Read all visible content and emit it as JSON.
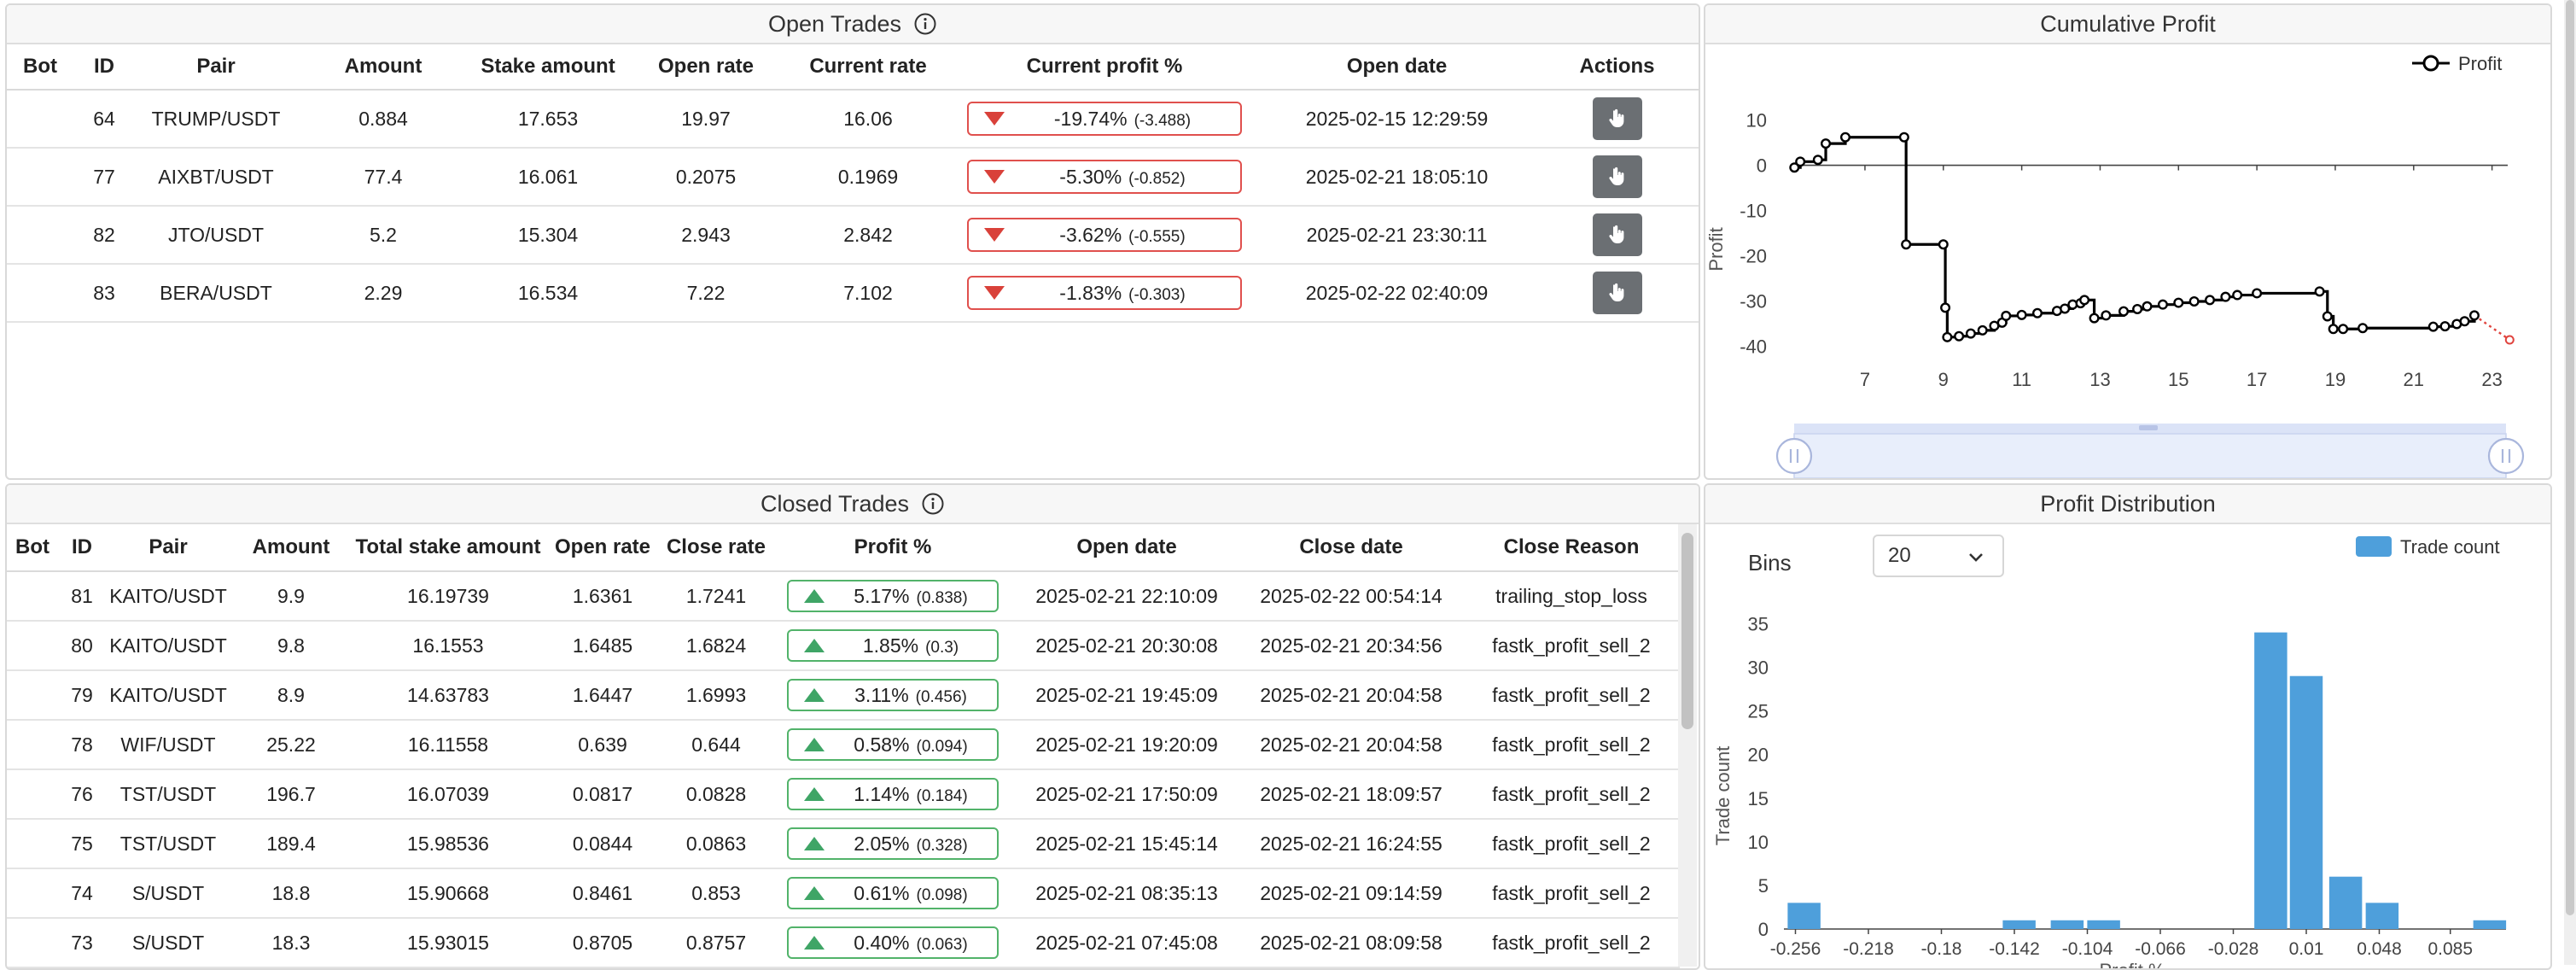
{
  "open_trades": {
    "title": "Open Trades",
    "columns": [
      "Bot",
      "ID",
      "Pair",
      "Amount",
      "Stake amount",
      "Open rate",
      "Current rate",
      "Current profit %",
      "Open date",
      "Actions"
    ],
    "rows": [
      {
        "bot": "",
        "id": "64",
        "pair": "TRUMP/USDT",
        "amount": "0.884",
        "stake": "17.653",
        "open_rate": "19.97",
        "current_rate": "16.06",
        "profit": "-19.74%",
        "profit_abs": "(-3.488)",
        "open_date": "2025-02-15 12:29:59"
      },
      {
        "bot": "",
        "id": "77",
        "pair": "AIXBT/USDT",
        "amount": "77.4",
        "stake": "16.061",
        "open_rate": "0.2075",
        "current_rate": "0.1969",
        "profit": "-5.30%",
        "profit_abs": "(-0.852)",
        "open_date": "2025-02-21 18:05:10"
      },
      {
        "bot": "",
        "id": "82",
        "pair": "JTO/USDT",
        "amount": "5.2",
        "stake": "15.304",
        "open_rate": "2.943",
        "current_rate": "2.842",
        "profit": "-3.62%",
        "profit_abs": "(-0.555)",
        "open_date": "2025-02-21 23:30:11"
      },
      {
        "bot": "",
        "id": "83",
        "pair": "BERA/USDT",
        "amount": "2.29",
        "stake": "16.534",
        "open_rate": "7.22",
        "current_rate": "7.102",
        "profit": "-1.83%",
        "profit_abs": "(-0.303)",
        "open_date": "2025-02-22 02:40:09"
      }
    ]
  },
  "closed_trades": {
    "title": "Closed Trades",
    "columns": [
      "Bot",
      "ID",
      "Pair",
      "Amount",
      "Total stake amount",
      "Open rate",
      "Close rate",
      "Profit %",
      "Open date",
      "Close date",
      "Close Reason"
    ],
    "rows": [
      {
        "bot": "",
        "id": "81",
        "pair": "KAITO/USDT",
        "amount": "9.9",
        "stake": "16.19739",
        "open_rate": "1.6361",
        "close_rate": "1.7241",
        "profit": "5.17%",
        "profit_abs": "(0.838)",
        "open_date": "2025-02-21 22:10:09",
        "close_date": "2025-02-22 00:54:14",
        "reason": "trailing_stop_loss"
      },
      {
        "bot": "",
        "id": "80",
        "pair": "KAITO/USDT",
        "amount": "9.8",
        "stake": "16.1553",
        "open_rate": "1.6485",
        "close_rate": "1.6824",
        "profit": "1.85%",
        "profit_abs": "(0.3)",
        "open_date": "2025-02-21 20:30:08",
        "close_date": "2025-02-21 20:34:56",
        "reason": "fastk_profit_sell_2"
      },
      {
        "bot": "",
        "id": "79",
        "pair": "KAITO/USDT",
        "amount": "8.9",
        "stake": "14.63783",
        "open_rate": "1.6447",
        "close_rate": "1.6993",
        "profit": "3.11%",
        "profit_abs": "(0.456)",
        "open_date": "2025-02-21 19:45:09",
        "close_date": "2025-02-21 20:04:58",
        "reason": "fastk_profit_sell_2"
      },
      {
        "bot": "",
        "id": "78",
        "pair": "WIF/USDT",
        "amount": "25.22",
        "stake": "16.11558",
        "open_rate": "0.639",
        "close_rate": "0.644",
        "profit": "0.58%",
        "profit_abs": "(0.094)",
        "open_date": "2025-02-21 19:20:09",
        "close_date": "2025-02-21 20:04:58",
        "reason": "fastk_profit_sell_2"
      },
      {
        "bot": "",
        "id": "76",
        "pair": "TST/USDT",
        "amount": "196.7",
        "stake": "16.07039",
        "open_rate": "0.0817",
        "close_rate": "0.0828",
        "profit": "1.14%",
        "profit_abs": "(0.184)",
        "open_date": "2025-02-21 17:50:09",
        "close_date": "2025-02-21 18:09:57",
        "reason": "fastk_profit_sell_2"
      },
      {
        "bot": "",
        "id": "75",
        "pair": "TST/USDT",
        "amount": "189.4",
        "stake": "15.98536",
        "open_rate": "0.0844",
        "close_rate": "0.0863",
        "profit": "2.05%",
        "profit_abs": "(0.328)",
        "open_date": "2025-02-21 15:45:14",
        "close_date": "2025-02-21 16:24:55",
        "reason": "fastk_profit_sell_2"
      },
      {
        "bot": "",
        "id": "74",
        "pair": "S/USDT",
        "amount": "18.8",
        "stake": "15.90668",
        "open_rate": "0.8461",
        "close_rate": "0.853",
        "profit": "0.61%",
        "profit_abs": "(0.098)",
        "open_date": "2025-02-21 08:35:13",
        "close_date": "2025-02-21 09:14:59",
        "reason": "fastk_profit_sell_2"
      },
      {
        "bot": "",
        "id": "73",
        "pair": "S/USDT",
        "amount": "18.3",
        "stake": "15.93015",
        "open_rate": "0.8705",
        "close_rate": "0.8757",
        "profit": "0.40%",
        "profit_abs": "(0.063)",
        "open_date": "2025-02-21 07:45:08",
        "close_date": "2025-02-21 08:09:58",
        "reason": "fastk_profit_sell_2"
      }
    ]
  },
  "cumulative_profit": {
    "title": "Cumulative Profit",
    "legend": "Profit",
    "ylabel": "Profit",
    "colors": {
      "line": "#000000",
      "projection": "#e0443e",
      "zoom": "#dbe3f7"
    }
  },
  "profit_distribution": {
    "title": "Profit Distribution",
    "bins_label": "Bins",
    "bins_value": "20",
    "legend": "Trade count",
    "color": "#4e9fdb"
  },
  "chart_data": [
    {
      "type": "line",
      "title": "Cumulative Profit",
      "ylabel": "Profit",
      "xlabel": "",
      "series_name": "Profit",
      "x_ticks": [
        "7",
        "9",
        "11",
        "13",
        "15",
        "17",
        "19",
        "21",
        "23"
      ],
      "y_ticks": [
        "10",
        "0",
        "-10",
        "-20",
        "-30",
        "-40"
      ],
      "xlim": [
        5.15,
        23.4
      ],
      "ylim": [
        -42,
        12
      ],
      "points": [
        [
          5.2,
          -0.5
        ],
        [
          5.35,
          0.8
        ],
        [
          5.8,
          1.2
        ],
        [
          6.0,
          4.8
        ],
        [
          6.5,
          6.2
        ],
        [
          8.0,
          6.2
        ],
        [
          8.05,
          -17.5
        ],
        [
          9.0,
          -17.5
        ],
        [
          9.05,
          -31.5
        ],
        [
          9.1,
          -38.0
        ],
        [
          9.4,
          -37.8
        ],
        [
          9.7,
          -37.2
        ],
        [
          10.0,
          -36.5
        ],
        [
          10.3,
          -35.5
        ],
        [
          10.5,
          -34.8
        ],
        [
          10.6,
          -33.3
        ],
        [
          11.0,
          -33.1
        ],
        [
          11.4,
          -32.7
        ],
        [
          11.9,
          -32.2
        ],
        [
          12.1,
          -31.7
        ],
        [
          12.3,
          -30.8
        ],
        [
          12.5,
          -30.5
        ],
        [
          12.6,
          -29.8
        ],
        [
          12.85,
          -33.8
        ],
        [
          13.15,
          -33.2
        ],
        [
          13.6,
          -32.3
        ],
        [
          13.95,
          -31.8
        ],
        [
          14.2,
          -31.2
        ],
        [
          14.6,
          -30.8
        ],
        [
          15.0,
          -30.4
        ],
        [
          15.4,
          -30.1
        ],
        [
          15.8,
          -29.8
        ],
        [
          16.2,
          -29.1
        ],
        [
          16.5,
          -28.7
        ],
        [
          17.0,
          -28.3
        ],
        [
          18.6,
          -27.9
        ],
        [
          18.8,
          -33.4
        ],
        [
          18.95,
          -36.2
        ],
        [
          19.2,
          -36.2
        ],
        [
          19.7,
          -36.0
        ],
        [
          21.5,
          -35.7
        ],
        [
          21.8,
          -35.6
        ],
        [
          22.1,
          -35.1
        ],
        [
          22.3,
          -34.5
        ],
        [
          22.55,
          -33.2
        ]
      ],
      "projection": [
        [
          22.55,
          -33.2
        ],
        [
          23.45,
          -38.6
        ]
      ]
    },
    {
      "type": "bar",
      "title": "Profit Distribution",
      "xlabel": "Profit %",
      "ylabel": "Trade count",
      "series_name": "Trade count",
      "x_ticks": [
        "-0.256",
        "-0.218",
        "-0.18",
        "-0.142",
        "-0.104",
        "-0.066",
        "-0.028",
        "0.01",
        "0.048",
        "0.085"
      ],
      "y_ticks": [
        "0",
        "5",
        "10",
        "15",
        "20",
        "25",
        "30",
        "35"
      ],
      "xlim": [
        -0.262,
        0.114
      ],
      "ylim": [
        0,
        37
      ],
      "bin_width": 0.0171,
      "bins": [
        {
          "center": -0.2515,
          "count": 3
        },
        {
          "center": -0.1395,
          "count": 1
        },
        {
          "center": -0.1145,
          "count": 1
        },
        {
          "center": -0.0955,
          "count": 1
        },
        {
          "center": -0.0085,
          "count": 34
        },
        {
          "center": 0.01,
          "count": 29
        },
        {
          "center": 0.0305,
          "count": 6
        },
        {
          "center": 0.0495,
          "count": 3
        },
        {
          "center": 0.1055,
          "count": 1
        }
      ]
    }
  ]
}
